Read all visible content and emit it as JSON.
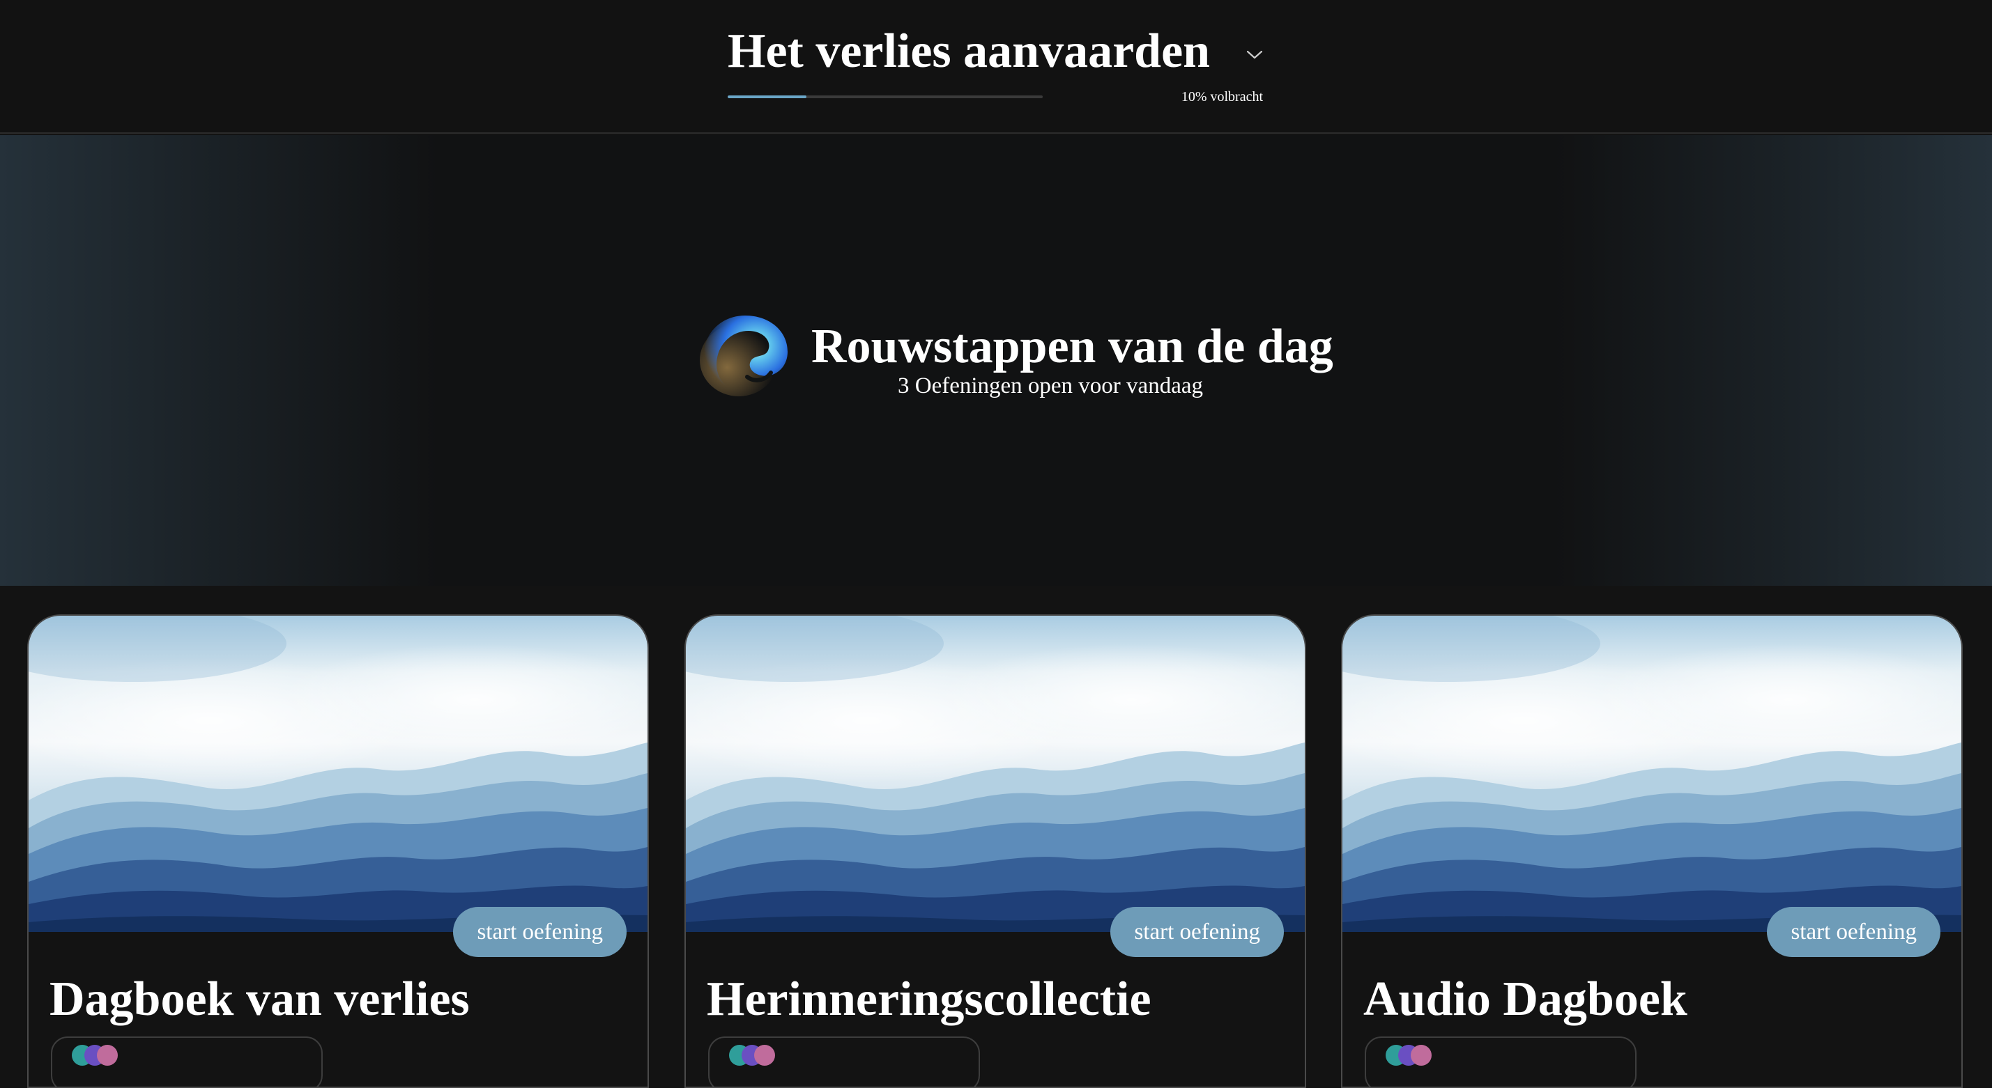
{
  "header": {
    "title": "Het verlies aanvaarden",
    "progress_fraction": 0.25,
    "progress_text": "10% volbracht",
    "dropdown_icon": "chevron-down-icon"
  },
  "hero": {
    "icon": "spiral-logo-icon",
    "title": "Rouwstappen van de dag",
    "subtitle": "3 Oefeningen open voor vandaag"
  },
  "cards": [
    {
      "title": "Dagboek van verlies",
      "button_label": "start oefening"
    },
    {
      "title": "Herinneringscollectie",
      "button_label": "start oefening"
    },
    {
      "title": "Audio Dagboek",
      "button_label": "start oefening"
    }
  ],
  "colors": {
    "accent": "#6e9cb8",
    "progress_fill": "#6aa6c7",
    "background": "#131313"
  }
}
